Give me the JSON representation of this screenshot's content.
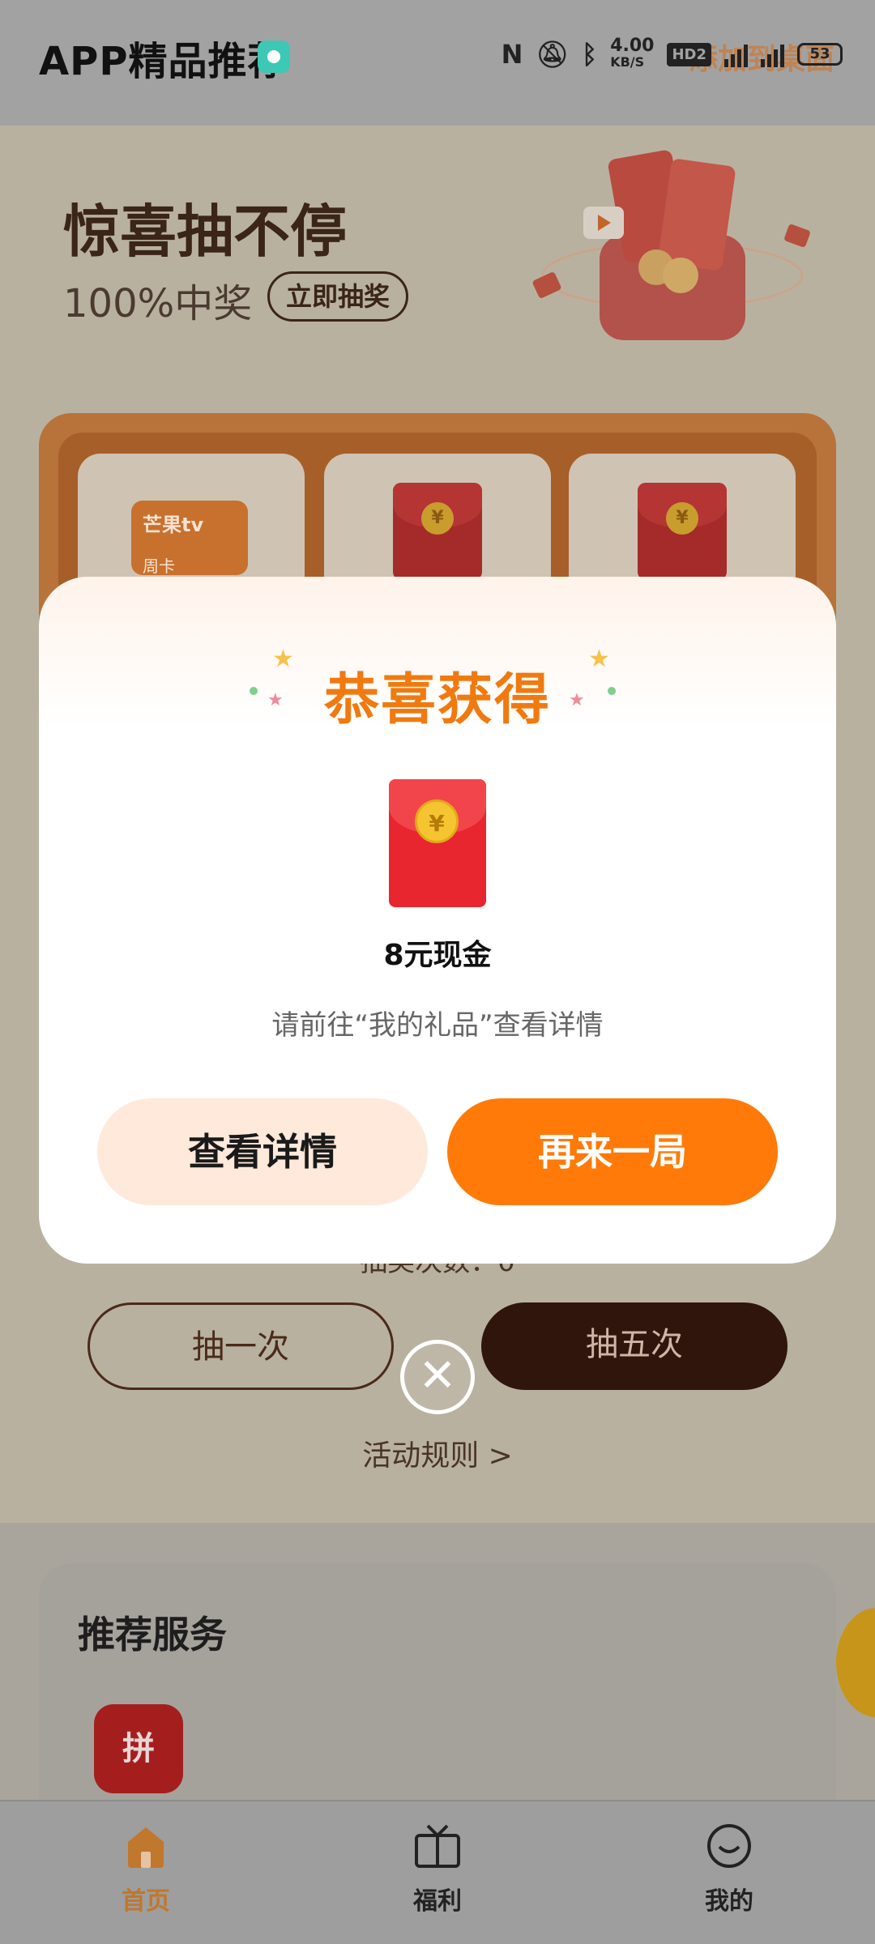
{
  "header": {
    "app_title": "APP精品推荐",
    "status": {
      "speed_value": "4.00",
      "speed_unit": "KB/S",
      "hd_label": "HD2",
      "net1": "4G",
      "net2": "4G",
      "battery": "53"
    },
    "add_to_home": "添加到桌面"
  },
  "promo": {
    "title": "惊喜抽不停",
    "subtitle": "100%中奖",
    "cta": "立即抽奖",
    "prizes": [
      {
        "brand": "芒果tv",
        "label": "周卡"
      },
      {
        "type": "red-envelope"
      },
      {
        "type": "red-envelope"
      }
    ],
    "draw_count": "抽奖次数：0",
    "draw_once": "抽一次",
    "draw_five": "抽五次",
    "rules": "活动规则 >"
  },
  "recommend": {
    "title": "推荐服务",
    "app_glyph": "拼"
  },
  "modal": {
    "title": "恭喜获得",
    "prize_name": "8元现金",
    "hint": "请前往“我的礼品”查看详情",
    "btn_detail": "查看详情",
    "btn_again": "再来一局",
    "coin_symbol": "¥"
  },
  "nav": {
    "home": "首页",
    "fuli": "福利",
    "mine": "我的",
    "active_color": "#c0772e"
  },
  "colors": {
    "accent_orange": "#ff7a08",
    "title_orange": "#f07a10",
    "dark_brown": "#2f150c"
  }
}
